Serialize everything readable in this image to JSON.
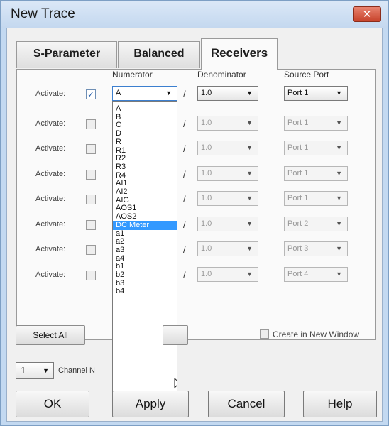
{
  "window": {
    "title": "New Trace",
    "close_glyph": "✕"
  },
  "tabs": [
    {
      "label": "S-Parameter",
      "active": false
    },
    {
      "label": "Balanced",
      "active": false
    },
    {
      "label": "Receivers",
      "active": true
    }
  ],
  "columns": {
    "numerator": "Numerator",
    "denominator": "Denominator",
    "source_port": "Source Port"
  },
  "rows": [
    {
      "label": "Activate:",
      "checked": true,
      "numerator": "A",
      "denominator": "1.0",
      "source_port": "Port 1"
    },
    {
      "label": "Activate:",
      "checked": false,
      "denominator": "1.0",
      "source_port": "Port 1"
    },
    {
      "label": "Activate:",
      "checked": false,
      "denominator": "1.0",
      "source_port": "Port 1"
    },
    {
      "label": "Activate:",
      "checked": false,
      "denominator": "1.0",
      "source_port": "Port 1"
    },
    {
      "label": "Activate:",
      "checked": false,
      "denominator": "1.0",
      "source_port": "Port 1"
    },
    {
      "label": "Activate:",
      "checked": false,
      "denominator": "1.0",
      "source_port": "Port 2"
    },
    {
      "label": "Activate:",
      "checked": false,
      "denominator": "1.0",
      "source_port": "Port 3"
    },
    {
      "label": "Activate:",
      "checked": false,
      "denominator": "1.0",
      "source_port": "Port 4"
    }
  ],
  "slash": "/",
  "numerator_dropdown": {
    "items": [
      "A",
      "B",
      "C",
      "D",
      "R",
      "R1",
      "R2",
      "R3",
      "R4",
      "AI1",
      "AI2",
      "AIG",
      "AOS1",
      "AOS2",
      "DC Meter",
      "a1",
      "a2",
      "a3",
      "a4",
      "b1",
      "b2",
      "b3",
      "b4"
    ],
    "selected": "DC Meter"
  },
  "buttons": {
    "select_all": "Select All",
    "ok": "OK",
    "apply": "Apply",
    "cancel": "Cancel",
    "help": "Help"
  },
  "create_new_window": {
    "label": "Create in New Window",
    "checked": false
  },
  "channel": {
    "value": "1",
    "label": "Channel N"
  },
  "icons": {
    "dropdown_arrow": "▼",
    "check": "✓"
  }
}
